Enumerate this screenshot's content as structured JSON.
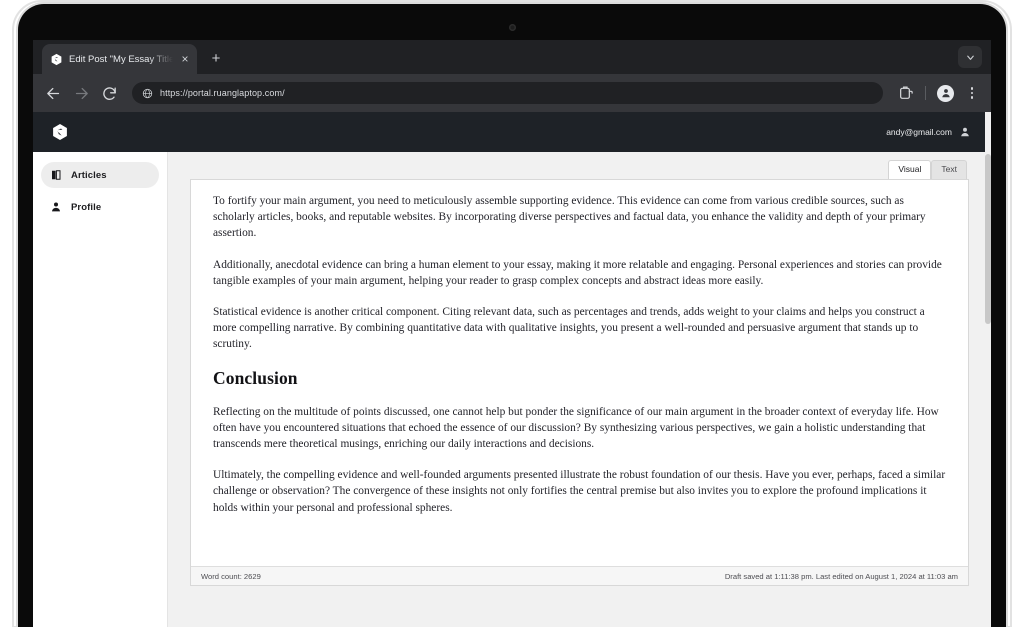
{
  "browser": {
    "tab": {
      "title": "Edit Post \"My Essay Title\" ‹ R",
      "favicon_icon": "site-hexagon-favicon",
      "close_icon": "close-icon"
    },
    "new_tab_label": "+",
    "tab_list_icon": "chevron-down-icon",
    "back_icon": "back-arrow-icon",
    "forward_icon": "forward-arrow-icon",
    "reload_icon": "reload-icon",
    "omnibox": {
      "site_icon": "globe-icon",
      "url": "https://portal.ruanglaptop.com/"
    },
    "share_icon": "share-tab-icon",
    "profile_icon": "profile-avatar-icon",
    "menu_icon": "kebab-menu-icon"
  },
  "app": {
    "logo_icon": "brand-hexagon-logo",
    "user": {
      "email": "andy@gmail.com",
      "avatar_icon": "user-avatar-icon"
    },
    "sidebar": {
      "items": [
        {
          "label": "Articles",
          "icon": "book-icon",
          "active": true
        },
        {
          "label": "Profile",
          "icon": "person-icon",
          "active": false
        }
      ]
    },
    "editor": {
      "tabs": [
        {
          "label": "Visual",
          "active": true
        },
        {
          "label": "Text",
          "active": false
        }
      ],
      "heading": "Conclusion",
      "paragraphs": [
        "To fortify your main argument, you need to meticulously assemble supporting evidence. This evidence can come from various credible sources, such as scholarly articles, books, and reputable websites. By incorporating diverse perspectives and factual data, you enhance the validity and depth of your primary assertion.",
        "Additionally, anecdotal evidence can bring a human element to your essay, making it more relatable and engaging. Personal experiences and stories can provide tangible examples of your main argument, helping your reader to grasp complex concepts and abstract ideas more easily.",
        "Statistical evidence is another critical component. Citing relevant data, such as percentages and trends, adds weight to your claims and helps you construct a more compelling narrative. By combining quantitative data with qualitative insights, you present a well-rounded and persuasive argument that stands up to scrutiny."
      ],
      "conclusion_paragraphs": [
        "Reflecting on the multitude of points discussed, one cannot help but ponder the significance of our main argument in the broader context of everyday life. How often have you encountered situations that echoed the essence of our discussion? By synthesizing various perspectives, we gain a holistic understanding that transcends mere theoretical musings, enriching our daily interactions and decisions.",
        "Ultimately, the compelling evidence and well-founded arguments presented illustrate the robust foundation of our thesis. Have you ever, perhaps, faced a similar challenge or observation? The convergence of these insights not only fortifies the central premise but also invites you to explore the profound implications it holds within your personal and professional spheres."
      ],
      "status": {
        "word_count": "Word count: 2629",
        "saved": "Draft saved at 1:11:38 pm. Last edited on August 1, 2024 at 11:03 am"
      }
    }
  },
  "colors": {
    "chrome_tabstrip": "#202124",
    "chrome_toolbar": "#35363a",
    "app_header": "#1e2227",
    "page_bg": "#f1f1f1",
    "sidebar_active": "#ededed"
  }
}
